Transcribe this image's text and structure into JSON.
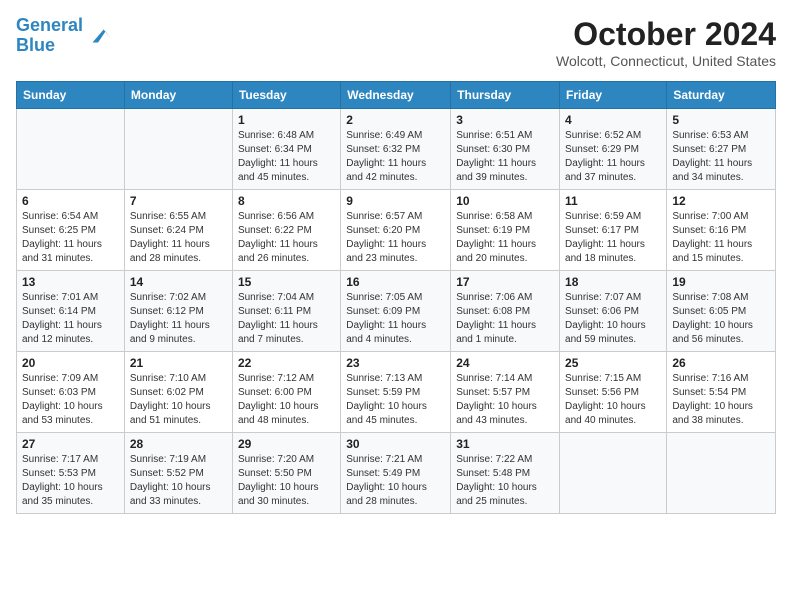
{
  "header": {
    "logo_line1": "General",
    "logo_line2": "Blue",
    "month": "October 2024",
    "location": "Wolcott, Connecticut, United States"
  },
  "days_of_week": [
    "Sunday",
    "Monday",
    "Tuesday",
    "Wednesday",
    "Thursday",
    "Friday",
    "Saturday"
  ],
  "weeks": [
    [
      {
        "day": "",
        "info": ""
      },
      {
        "day": "",
        "info": ""
      },
      {
        "day": "1",
        "info": "Sunrise: 6:48 AM\nSunset: 6:34 PM\nDaylight: 11 hours and 45 minutes."
      },
      {
        "day": "2",
        "info": "Sunrise: 6:49 AM\nSunset: 6:32 PM\nDaylight: 11 hours and 42 minutes."
      },
      {
        "day": "3",
        "info": "Sunrise: 6:51 AM\nSunset: 6:30 PM\nDaylight: 11 hours and 39 minutes."
      },
      {
        "day": "4",
        "info": "Sunrise: 6:52 AM\nSunset: 6:29 PM\nDaylight: 11 hours and 37 minutes."
      },
      {
        "day": "5",
        "info": "Sunrise: 6:53 AM\nSunset: 6:27 PM\nDaylight: 11 hours and 34 minutes."
      }
    ],
    [
      {
        "day": "6",
        "info": "Sunrise: 6:54 AM\nSunset: 6:25 PM\nDaylight: 11 hours and 31 minutes."
      },
      {
        "day": "7",
        "info": "Sunrise: 6:55 AM\nSunset: 6:24 PM\nDaylight: 11 hours and 28 minutes."
      },
      {
        "day": "8",
        "info": "Sunrise: 6:56 AM\nSunset: 6:22 PM\nDaylight: 11 hours and 26 minutes."
      },
      {
        "day": "9",
        "info": "Sunrise: 6:57 AM\nSunset: 6:20 PM\nDaylight: 11 hours and 23 minutes."
      },
      {
        "day": "10",
        "info": "Sunrise: 6:58 AM\nSunset: 6:19 PM\nDaylight: 11 hours and 20 minutes."
      },
      {
        "day": "11",
        "info": "Sunrise: 6:59 AM\nSunset: 6:17 PM\nDaylight: 11 hours and 18 minutes."
      },
      {
        "day": "12",
        "info": "Sunrise: 7:00 AM\nSunset: 6:16 PM\nDaylight: 11 hours and 15 minutes."
      }
    ],
    [
      {
        "day": "13",
        "info": "Sunrise: 7:01 AM\nSunset: 6:14 PM\nDaylight: 11 hours and 12 minutes."
      },
      {
        "day": "14",
        "info": "Sunrise: 7:02 AM\nSunset: 6:12 PM\nDaylight: 11 hours and 9 minutes."
      },
      {
        "day": "15",
        "info": "Sunrise: 7:04 AM\nSunset: 6:11 PM\nDaylight: 11 hours and 7 minutes."
      },
      {
        "day": "16",
        "info": "Sunrise: 7:05 AM\nSunset: 6:09 PM\nDaylight: 11 hours and 4 minutes."
      },
      {
        "day": "17",
        "info": "Sunrise: 7:06 AM\nSunset: 6:08 PM\nDaylight: 11 hours and 1 minute."
      },
      {
        "day": "18",
        "info": "Sunrise: 7:07 AM\nSunset: 6:06 PM\nDaylight: 10 hours and 59 minutes."
      },
      {
        "day": "19",
        "info": "Sunrise: 7:08 AM\nSunset: 6:05 PM\nDaylight: 10 hours and 56 minutes."
      }
    ],
    [
      {
        "day": "20",
        "info": "Sunrise: 7:09 AM\nSunset: 6:03 PM\nDaylight: 10 hours and 53 minutes."
      },
      {
        "day": "21",
        "info": "Sunrise: 7:10 AM\nSunset: 6:02 PM\nDaylight: 10 hours and 51 minutes."
      },
      {
        "day": "22",
        "info": "Sunrise: 7:12 AM\nSunset: 6:00 PM\nDaylight: 10 hours and 48 minutes."
      },
      {
        "day": "23",
        "info": "Sunrise: 7:13 AM\nSunset: 5:59 PM\nDaylight: 10 hours and 45 minutes."
      },
      {
        "day": "24",
        "info": "Sunrise: 7:14 AM\nSunset: 5:57 PM\nDaylight: 10 hours and 43 minutes."
      },
      {
        "day": "25",
        "info": "Sunrise: 7:15 AM\nSunset: 5:56 PM\nDaylight: 10 hours and 40 minutes."
      },
      {
        "day": "26",
        "info": "Sunrise: 7:16 AM\nSunset: 5:54 PM\nDaylight: 10 hours and 38 minutes."
      }
    ],
    [
      {
        "day": "27",
        "info": "Sunrise: 7:17 AM\nSunset: 5:53 PM\nDaylight: 10 hours and 35 minutes."
      },
      {
        "day": "28",
        "info": "Sunrise: 7:19 AM\nSunset: 5:52 PM\nDaylight: 10 hours and 33 minutes."
      },
      {
        "day": "29",
        "info": "Sunrise: 7:20 AM\nSunset: 5:50 PM\nDaylight: 10 hours and 30 minutes."
      },
      {
        "day": "30",
        "info": "Sunrise: 7:21 AM\nSunset: 5:49 PM\nDaylight: 10 hours and 28 minutes."
      },
      {
        "day": "31",
        "info": "Sunrise: 7:22 AM\nSunset: 5:48 PM\nDaylight: 10 hours and 25 minutes."
      },
      {
        "day": "",
        "info": ""
      },
      {
        "day": "",
        "info": ""
      }
    ]
  ]
}
